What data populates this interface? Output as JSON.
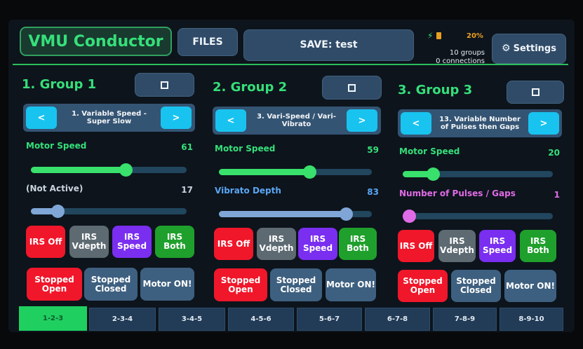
{
  "header": {
    "app_title": "VMU Conductor",
    "files_label": "FILES",
    "save_label": "SAVE: test",
    "battery_percent": "20%",
    "groups_count": "10 groups",
    "connections_count": "0 connections",
    "settings_label": "Settings"
  },
  "groups": [
    {
      "title": "1. Group 1",
      "preset": "1. Variable Speed - Super Slow",
      "prev": "<",
      "next": ">",
      "slider1": {
        "label": "Motor Speed",
        "value": "61",
        "level": 0.61
      },
      "slider2": {
        "label": "(Not Active)",
        "value": "17",
        "level": 0.17
      },
      "irs_off": "IRS Off",
      "irs_vdepth": "IRS Vdepth",
      "irs_speed": "IRS Speed",
      "irs_both": "IRS Both",
      "stopped_open": "Stopped Open",
      "stopped_closed": "Stopped Closed",
      "motor_on": "Motor ON!"
    },
    {
      "title": "2. Group 2",
      "preset": "3. Vari-Speed / Vari-Vibrato",
      "prev": "<",
      "next": ">",
      "slider1": {
        "label": "Motor Speed",
        "value": "59",
        "level": 0.59
      },
      "slider2": {
        "label": "Vibrato Depth",
        "value": "83",
        "level": 0.83
      },
      "irs_off": "IRS Off",
      "irs_vdepth": "IRS Vdepth",
      "irs_speed": "IRS Speed",
      "irs_both": "IRS Both",
      "stopped_open": "Stopped Open",
      "stopped_closed": "Stopped Closed",
      "motor_on": "Motor ON!"
    },
    {
      "title": "3. Group 3",
      "preset": "13. Variable Number of Pulses then Gaps",
      "prev": "<",
      "next": ">",
      "slider1": {
        "label": "Motor Speed",
        "value": "20",
        "level": 0.2
      },
      "slider2": {
        "label": "Number of Pulses / Gaps",
        "value": "1",
        "level": 0.01
      },
      "irs_off": "IRS Off",
      "irs_vdepth": "IRS Vdepth",
      "irs_speed": "IRS Speed",
      "irs_both": "IRS Both",
      "stopped_open": "Stopped Open",
      "stopped_closed": "Stopped Closed",
      "motor_on": "Motor ON!"
    }
  ],
  "tabs": [
    "1-2-3",
    "2-3-4",
    "3-4-5",
    "4-5-6",
    "5-6-7",
    "6-7-8",
    "7-8-9",
    "8-9-10"
  ],
  "colors": {
    "accent_green": "#35e07a",
    "irs_off": "#f0172a",
    "irs_vdepth": "#5d6a72",
    "irs_speed": "#7a2ef0",
    "irs_both": "#1fa02c",
    "slider_green": "#39e06c",
    "slider_blue": "#7fa6d6",
    "slider_magenta": "#e06be6",
    "active_tab": "#1fd060"
  },
  "icons": [
    "bolt-icon",
    "battery-icon",
    "gear-icon",
    "square-icon",
    "chevron-left-icon",
    "chevron-right-icon"
  ]
}
